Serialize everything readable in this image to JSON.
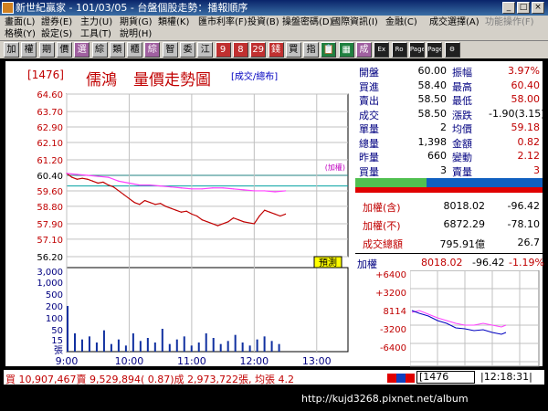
{
  "window": {
    "title": "新世紀贏家 - 101/03/05 - 台盤個股走勢：播報順序"
  },
  "menu_row1": [
    "畫面(L)",
    "證券(E)",
    "主力(U)",
    "期貨(G)",
    "類權(K)",
    "匯市利率(F)",
    "投資(B)",
    "操盤密碼(D)",
    "國際資訊(I)",
    "金融(C)",
    "成交選擇(A)",
    "功能操作(F)"
  ],
  "menu_row2": [
    "格模(Y)",
    "設定(S)",
    "工具(T)",
    "說明(H)"
  ],
  "toolbar": [
    "加",
    "權",
    "期",
    "價",
    "選",
    "綜",
    "類",
    "櫃",
    "綜",
    "智",
    "委",
    "江",
    "9",
    "8",
    "29",
    "錢",
    "買",
    "指",
    "📋",
    "▦",
    "成",
    "Ex",
    "Ro",
    "Page",
    "Page",
    "⚙"
  ],
  "chart": {
    "code": "1476",
    "name": "儒鴻",
    "title": "量價走勢圖",
    "subtitle": "成交/總布",
    "reference_label": "(加權)",
    "yprice_ticks": [
      "64.60",
      "63.70",
      "62.90",
      "62.10",
      "61.20",
      "60.40",
      "59.60",
      "58.80",
      "57.90",
      "57.10",
      "56.20"
    ],
    "yvol_ticks": [
      "3,000",
      "1,000",
      "500",
      "200",
      "100",
      "50",
      "15",
      "張"
    ],
    "xticks": [
      "9:00",
      "10:00",
      "11:00",
      "12:00",
      "13:00"
    ],
    "badge": "預測"
  },
  "chart_data": {
    "type": "line",
    "x_label": "",
    "ylim": [
      56.2,
      64.6
    ],
    "reference": 60.4,
    "series": [
      {
        "name": "price",
        "color": "#c00000",
        "x": [
          0,
          5,
          10,
          15,
          20,
          25,
          30,
          35,
          40,
          45,
          50,
          55,
          60,
          65,
          70,
          75,
          80,
          85,
          90,
          95,
          100,
          105,
          110,
          115,
          120,
          125,
          130,
          135,
          140,
          145,
          150,
          155,
          160,
          165,
          170,
          175,
          180,
          185,
          190,
          195,
          200,
          205,
          210
        ],
        "y": [
          60.5,
          60.3,
          60.2,
          60.25,
          60.2,
          60.1,
          60.0,
          60.05,
          59.9,
          59.8,
          59.6,
          59.4,
          59.2,
          59.0,
          58.9,
          59.1,
          59.0,
          58.9,
          58.95,
          58.8,
          58.7,
          58.6,
          58.5,
          58.55,
          58.4,
          58.3,
          58.1,
          58.0,
          57.9,
          57.8,
          57.9,
          58.0,
          58.2,
          58.1,
          58.0,
          57.95,
          57.9,
          58.3,
          58.6,
          58.5,
          58.4,
          58.3,
          58.4
        ]
      },
      {
        "name": "加權",
        "color": "#ff40ff",
        "x": [
          0,
          10,
          20,
          30,
          40,
          50,
          60,
          70,
          80,
          90,
          100,
          110,
          120,
          130,
          140,
          150,
          160,
          170,
          180,
          190,
          200,
          210
        ],
        "y": [
          60.5,
          60.45,
          60.4,
          60.35,
          60.3,
          60.1,
          60.0,
          59.9,
          59.9,
          59.85,
          59.8,
          59.75,
          59.7,
          59.7,
          59.75,
          59.75,
          59.7,
          59.65,
          59.6,
          59.6,
          59.55,
          59.6
        ]
      }
    ],
    "volume": [
      30,
      12,
      8,
      10,
      6,
      14,
      5,
      8,
      4,
      12,
      7,
      9,
      6,
      15,
      5,
      8,
      10,
      4,
      6,
      12,
      9,
      5,
      7,
      11,
      6,
      4,
      8,
      10,
      7,
      5
    ]
  },
  "quote": {
    "left": [
      [
        "開盤",
        "60.00"
      ],
      [
        "買進",
        "58.40"
      ],
      [
        "賣出",
        "58.50"
      ],
      [
        "成交",
        "58.50"
      ],
      [
        "單量",
        "2"
      ],
      [
        "總量",
        "1,398"
      ],
      [
        "昨量",
        "660"
      ],
      [
        "買量",
        "3"
      ]
    ],
    "right": [
      [
        "振幅",
        "3.97%"
      ],
      [
        "最高",
        "60.40"
      ],
      [
        "最低",
        "58.00"
      ],
      [
        "漲跌",
        "-1.90(3.15)"
      ],
      [
        "均價",
        "59.18"
      ],
      [
        "金額",
        "0.82"
      ],
      [
        "變動",
        "2.12"
      ],
      [
        "賣量",
        "3"
      ]
    ]
  },
  "index": {
    "rows": [
      [
        "加權(含)",
        "8018.02",
        "-96.42"
      ],
      [
        "加權(不)",
        "6872.29",
        "-78.10"
      ],
      [
        "成交總額",
        "795.91億",
        "26.7"
      ]
    ]
  },
  "mini": {
    "label": "加權",
    "value": "8018.02",
    "change": "-96.42",
    "pct": "-1.19%",
    "yticks": [
      "+6400",
      "+3200",
      "8114",
      "-3200",
      "-6400"
    ]
  },
  "status": {
    "text": "買 10,907,467賣 9,529,894( 0.87)成 2,973,722張, 均張 4.2",
    "code": "1476",
    "time": "12:18:31"
  },
  "footer": {
    "url": "http://kujd3268.pixnet.net/album"
  }
}
